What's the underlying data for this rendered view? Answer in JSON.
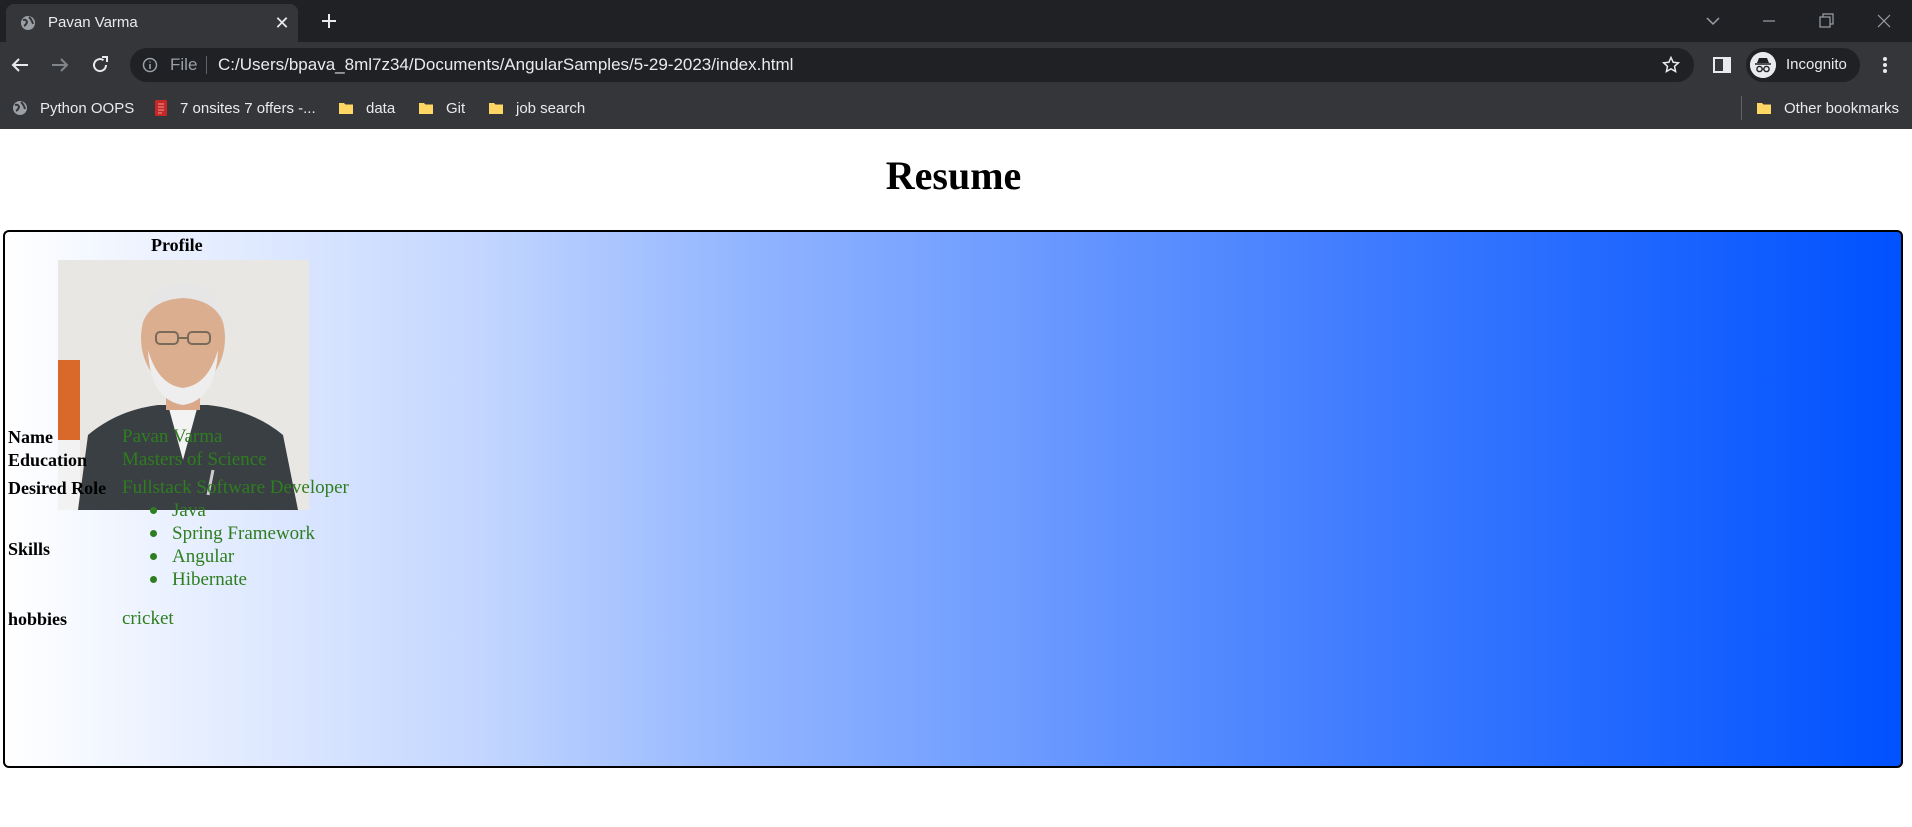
{
  "browser": {
    "tab": {
      "title": "Pavan Varma",
      "favicon": "globe-icon"
    },
    "address_bar": {
      "scheme": "File",
      "url": "C:/Users/bpava_8ml7z34/Documents/AngularSamples/5-29-2023/index.html"
    },
    "profile_label": "Incognito",
    "bookmarks": [
      {
        "label": "Python OOPS",
        "icon": "globe-icon"
      },
      {
        "label": "7 onsites 7 offers -...",
        "icon": "document-icon"
      },
      {
        "label": "data",
        "icon": "folder-icon"
      },
      {
        "label": "Git",
        "icon": "folder-icon"
      },
      {
        "label": "job search",
        "icon": "folder-icon"
      }
    ],
    "other_bookmarks": "Other bookmarks"
  },
  "page": {
    "title": "Resume",
    "profile_heading": "Profile",
    "rows": {
      "name": {
        "label": "Name",
        "value": "Pavan Varma"
      },
      "education": {
        "label": "Education",
        "value": "Masters of Science"
      },
      "desired_role": {
        "label": "Desired Role",
        "value": "Fullstack Software Developer"
      },
      "skills": {
        "label": "Skills",
        "items": [
          "Java",
          "Spring Framework",
          "Angular",
          "Hibernate"
        ]
      },
      "hobbies": {
        "label": "hobbies",
        "value": "cricket"
      }
    }
  },
  "colors": {
    "value_text": "#2e7d1f",
    "gradient_start": "#ffffff",
    "gradient_end": "#0052ff",
    "chrome_dark": "#35363a",
    "tabstrip": "#202124"
  }
}
